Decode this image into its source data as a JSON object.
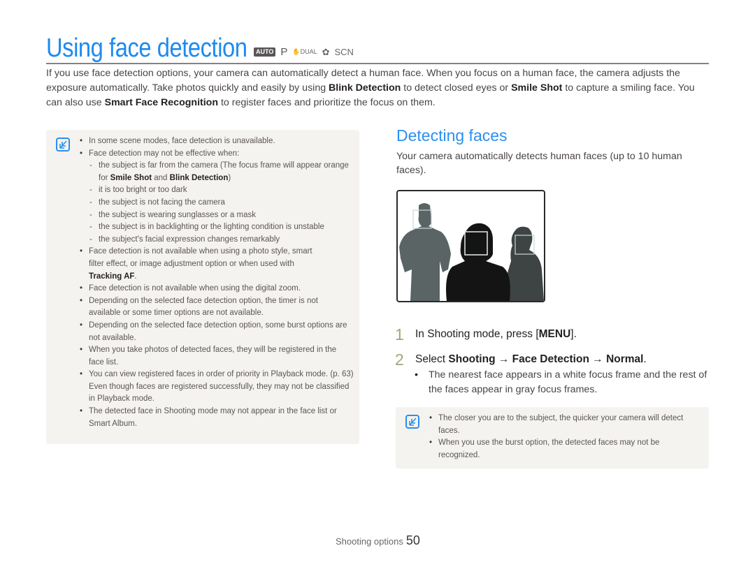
{
  "header": {
    "title": "Using face detection",
    "mode_icons": [
      {
        "icon": "auto-mode-icon",
        "label": "AUTO"
      },
      {
        "icon": "program-mode-icon",
        "label": "P"
      },
      {
        "icon": "dual-is-mode-icon",
        "label": "DUAL"
      },
      {
        "icon": "beauty-shot-mode-icon",
        "label": "✿"
      },
      {
        "icon": "scene-mode-icon",
        "label": "SCN"
      }
    ]
  },
  "intro": {
    "p1": "If you use face detection options, your camera can automatically detect a human face. When you focus on a human face, the camera adjusts the exposure automatically. Take photos quickly and easily by using ",
    "b1": "Blink Detection",
    "p2": " to detect closed eyes or ",
    "b2": "Smile Shot",
    "p3": " to capture a smiling face. You can also use ",
    "b3": "Smart Face Recognition",
    "p4": " to register faces and prioritize the focus on them."
  },
  "note_left": {
    "icon": "note-icon",
    "items": {
      "i1": "In some scene modes, face detection is unavailable.",
      "i2": "Face detection may not be effective when:",
      "i2_sub": {
        "s1a": "the subject is far from the camera (The focus frame will appear orange for ",
        "s1b": "Smile Shot",
        "s1c": " and ",
        "s1d": "Blink Detection",
        "s1e": ")",
        "s2": "it is too bright or too dark",
        "s3": "the subject is not facing the camera",
        "s4": "the subject is wearing sunglasses or a mask",
        "s5": "the subject is in backlighting or the lighting condition is unstable",
        "s6": "the subject's facial expression changes remarkably"
      },
      "i3a": "Face detection is not available when using a photo style, smart filter effect, or image adjustment option or when used with ",
      "i3b": "Tracking AF",
      "i3c": ".",
      "i4": "Face detection is not available when using the digital zoom.",
      "i5": "Depending on the selected face detection option, the timer is not available or some timer options are not available.",
      "i6": "Depending on the selected face detection option, some burst options are not available.",
      "i7": "When you take photos of detected faces, they will be registered in the face list.",
      "i8": "You can view registered faces in order of priority in Playback mode. (p. 63) Even though faces are registered successfully, they may not be classified in Playback mode.",
      "i9": "The detected face in Shooting mode may not appear in the face list or Smart Album."
    }
  },
  "section": {
    "heading": "Detecting faces",
    "description": "Your camera automatically detects human faces (up to 10 human faces).",
    "illustration": "face-detection-illustration"
  },
  "steps": {
    "s1": {
      "num": "1",
      "text_a": "In Shooting mode, press [",
      "text_b": "MENU",
      "text_c": "]."
    },
    "s2": {
      "num": "2",
      "text_a": "Select ",
      "b1": "Shooting",
      "arrow1": " → ",
      "b2": "Face Detection",
      "arrow2": " → ",
      "b3": "Normal",
      "end": ".",
      "bullet": "The nearest face appears in a white focus frame and the rest of the faces appear in gray focus frames."
    }
  },
  "note_right": {
    "icon": "note-icon",
    "items": {
      "i1": "The closer you are to the subject, the quicker your camera will detect faces.",
      "i2": "When you use the burst option, the detected faces may not be recognized."
    }
  },
  "footer": {
    "section": "Shooting options",
    "page": "50"
  }
}
